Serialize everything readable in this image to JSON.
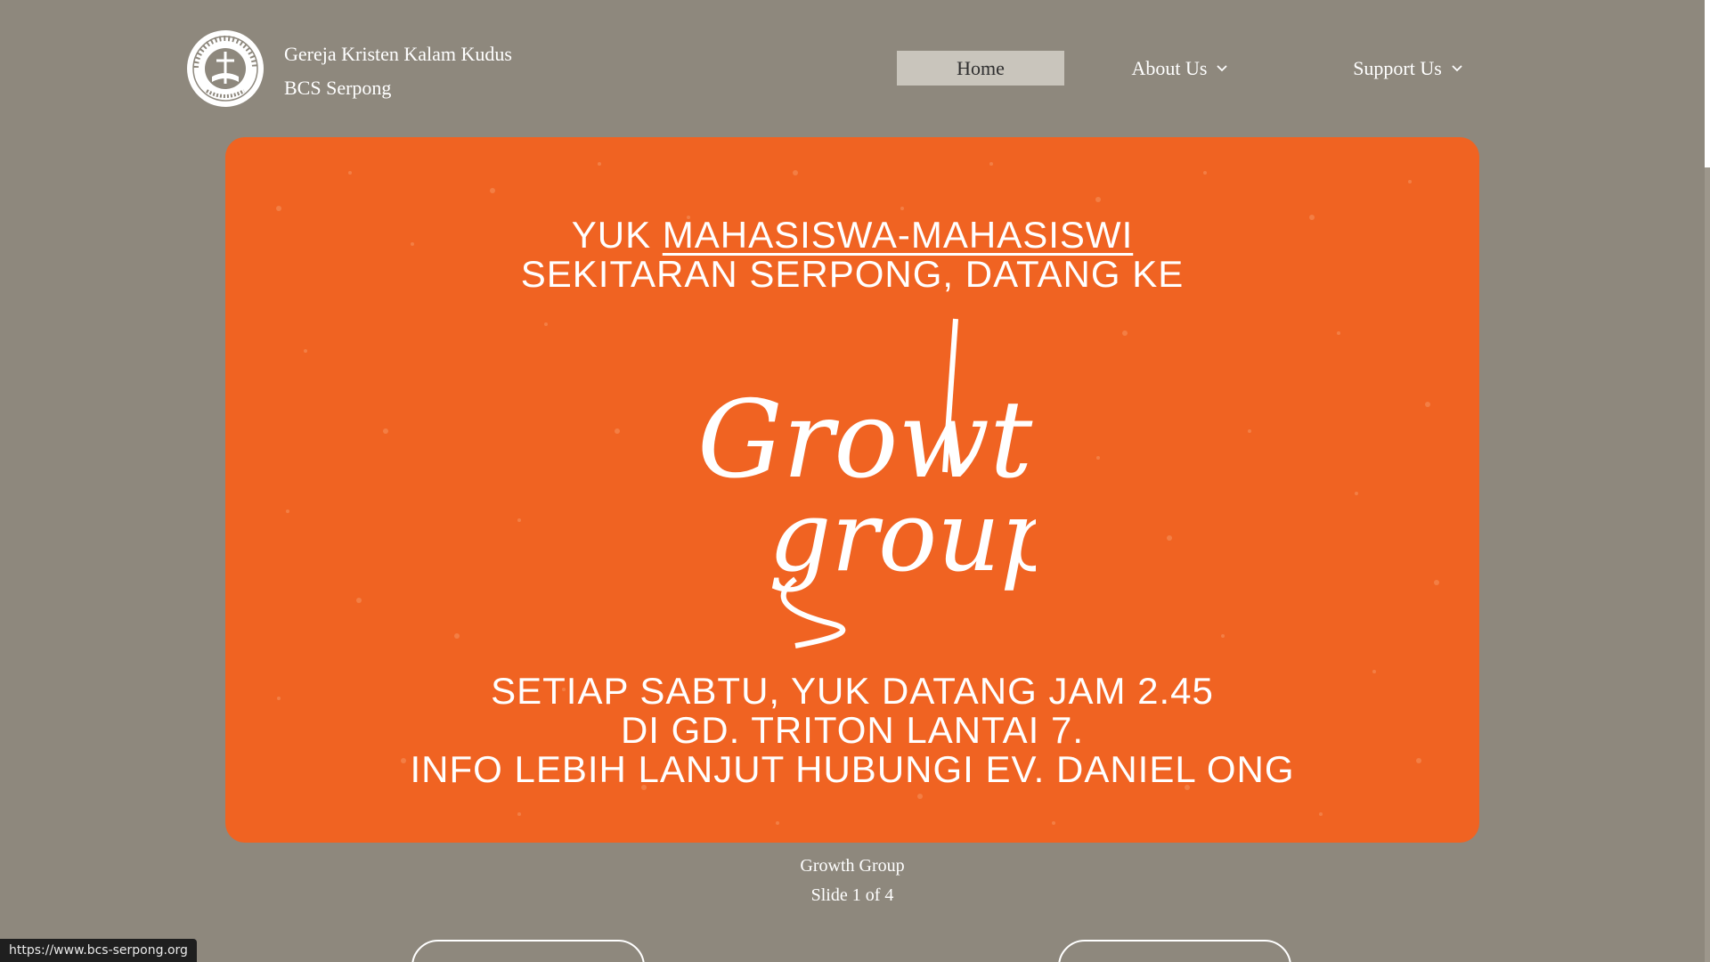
{
  "header": {
    "brand_line1": "Gereja Kristen Kalam Kudus",
    "brand_line2": "BCS Serpong",
    "logo_ring_text": "GEREJA KRISTEN KALAM KUDUS",
    "logo_bottom_text": "SERPONG",
    "logo_center_text": "KALAM KUDUS"
  },
  "nav": {
    "home": "Home",
    "about": "About Us",
    "support": "Support Us"
  },
  "hero": {
    "line1_prefix": "YUK ",
    "line1_emph": "MAHASISWA-MAHASISWI",
    "line2": "SEKITARAN SERPONG, DATANG KE",
    "logo_word1": "Growth",
    "logo_word2": "group",
    "line3": "SETIAP SABTU, YUK DATANG JAM 2.45",
    "line4": "DI GD. TRITON LANTAI 7.",
    "line5": "INFO LEBIH LANJUT HUBUNGI EV. DANIEL ONG",
    "accent": "#f06322"
  },
  "carousel": {
    "slide_title": "Growth Group",
    "slide_status": "Slide 1 of 4"
  },
  "statusbar": {
    "url": "https://www.bcs-serpong.org"
  }
}
